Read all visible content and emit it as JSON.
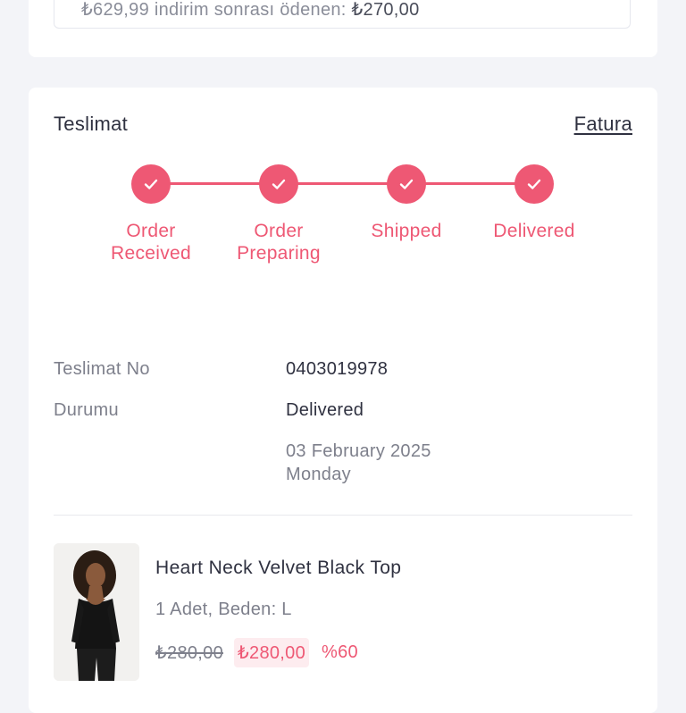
{
  "order_summary": {
    "prefix": "₺629,99 indirim sonrası ödenen:",
    "paid": "₺270,00"
  },
  "delivery": {
    "title": "Teslimat",
    "invoice_link": "Fatura",
    "accent_color": "#ee5874",
    "steps": [
      {
        "line1": "Order",
        "line2": "Received",
        "completed": true,
        "icon": "check-icon"
      },
      {
        "line1": "Order",
        "line2": "Preparing",
        "completed": true,
        "icon": "check-icon"
      },
      {
        "line1": "Shipped",
        "line2": "",
        "completed": true,
        "icon": "check-icon"
      },
      {
        "line1": "Delivered",
        "line2": "",
        "completed": true,
        "icon": "check-icon"
      }
    ],
    "number_label": "Teslimat No",
    "number_value": "0403019978",
    "status_label": "Durumu",
    "status_value": "Delivered",
    "date": "03 February 2025",
    "weekday": "Monday"
  },
  "product": {
    "name": "Heart Neck Velvet Black Top",
    "meta": "1 Adet, Beden: L",
    "price_old": "₺280,00",
    "price_new": "₺280,00",
    "discount": "%60"
  }
}
